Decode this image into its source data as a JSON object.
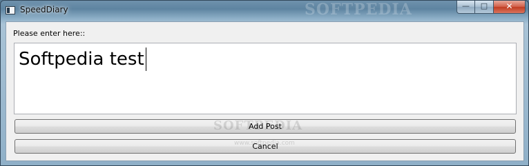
{
  "window": {
    "title": "SpeedDiary",
    "watermark": "SOFTPEDIA",
    "controls": {
      "minimize": "—",
      "maximize": "□",
      "close": "✕"
    }
  },
  "form": {
    "prompt_label": "Please enter here::",
    "editor_value": "Softpedia test",
    "add_button_label": "Add Post",
    "cancel_button_label": "Cancel"
  },
  "overlay": {
    "center_watermark": "SOFTPEDIA",
    "watermark_url": "www.softpedia.com"
  }
}
